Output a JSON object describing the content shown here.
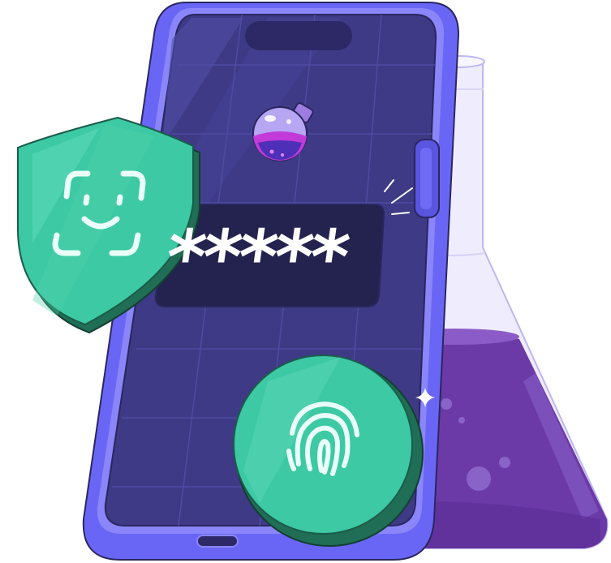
{
  "password_field": {
    "masked_value": "*****"
  },
  "colors": {
    "phone_body": "#6a66f5",
    "phone_screen": "#3e3a86",
    "password_box": "#24234f",
    "shield_green": "#3cc9a4",
    "shield_dark": "#1f6e55",
    "flask_liquid": "#6b3aa6",
    "flask_glass": "#eeecfd"
  },
  "icons": {
    "shield": "face-id-shield-icon",
    "fingerprint": "fingerprint-icon",
    "potion": "potion-bottle-icon",
    "flask": "erlenmeyer-flask-icon",
    "sparkle": "sparkle-icon"
  }
}
